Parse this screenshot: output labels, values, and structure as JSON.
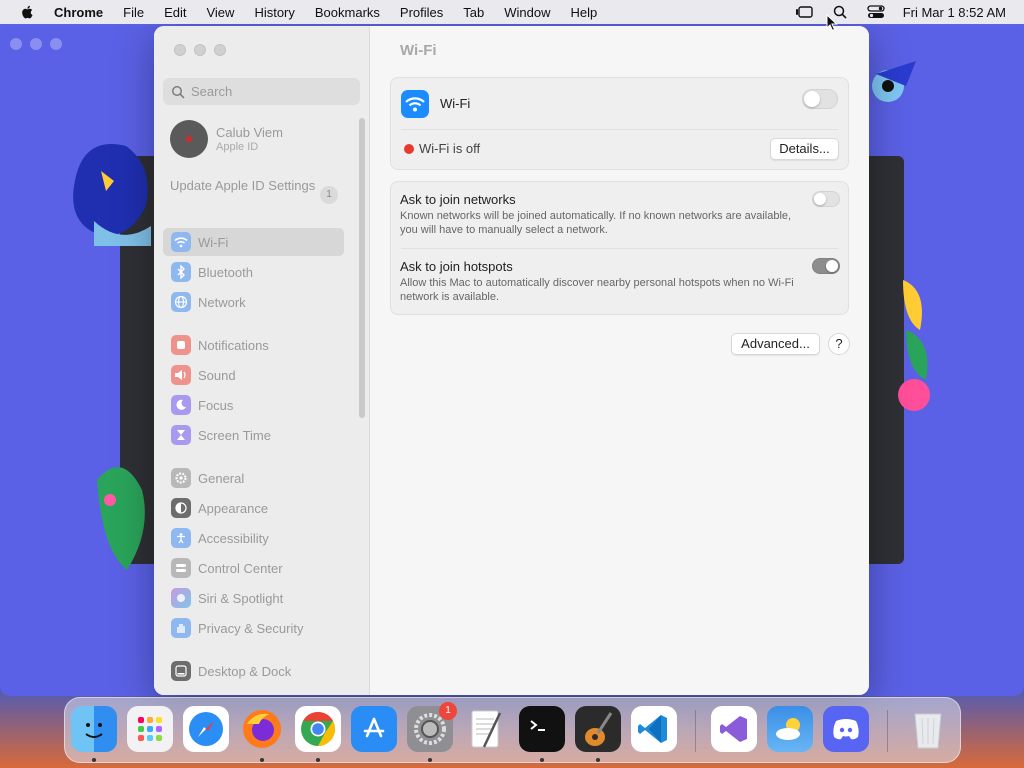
{
  "menubar": {
    "app_name": "Chrome",
    "items": [
      "File",
      "Edit",
      "View",
      "History",
      "Bookmarks",
      "Profiles",
      "Tab",
      "Window",
      "Help"
    ],
    "clock": "Fri Mar 1  8:52 AM"
  },
  "sidebar": {
    "search_placeholder": "Search",
    "profile": {
      "name": "Calub Viem",
      "subtitle": "Apple ID"
    },
    "update": {
      "label": "Update Apple ID Settings",
      "count": "1"
    },
    "items": [
      {
        "label": "Wi-Fi",
        "icon": "wifi-icon",
        "color": "#8fb8f0"
      },
      {
        "label": "Bluetooth",
        "icon": "bluetooth-icon",
        "color": "#8fb8f0"
      },
      {
        "label": "Network",
        "icon": "globe-icon",
        "color": "#8fb8f0"
      },
      {
        "label": "Notifications",
        "icon": "bell-icon",
        "color": "#f0928c"
      },
      {
        "label": "Sound",
        "icon": "speaker-icon",
        "color": "#f0928c"
      },
      {
        "label": "Focus",
        "icon": "moon-icon",
        "color": "#a99af0"
      },
      {
        "label": "Screen Time",
        "icon": "hourglass-icon",
        "color": "#a99af0"
      },
      {
        "label": "General",
        "icon": "gear-icon",
        "color": "#b8b8b8"
      },
      {
        "label": "Appearance",
        "icon": "appearance-icon",
        "color": "#6d6d6d"
      },
      {
        "label": "Accessibility",
        "icon": "accessibility-icon",
        "color": "#8fb8f0"
      },
      {
        "label": "Control Center",
        "icon": "control-center-icon",
        "color": "#b8b8b8"
      },
      {
        "label": "Siri & Spotlight",
        "icon": "siri-icon",
        "color": "#c79ae0"
      },
      {
        "label": "Privacy & Security",
        "icon": "hand-icon",
        "color": "#8fb8f0"
      },
      {
        "label": "Desktop & Dock",
        "icon": "dock-icon",
        "color": "#6d6d6d"
      }
    ]
  },
  "content": {
    "title": "Wi-Fi",
    "wifi_label": "Wi-Fi",
    "status": "Wi-Fi is off",
    "details_button": "Details...",
    "ask_networks": {
      "title": "Ask to join networks",
      "desc": "Known networks will be joined automatically. If no known networks are available, you will have to manually select a network."
    },
    "ask_hotspots": {
      "title": "Ask to join hotspots",
      "desc": "Allow this Mac to automatically discover nearby personal hotspots when no Wi-Fi network is available."
    },
    "advanced_button": "Advanced...",
    "help_button": "?"
  },
  "dock": {
    "apps": [
      "Finder",
      "Launchpad",
      "Safari",
      "Firefox",
      "Chrome",
      "App Store",
      "System Settings",
      "TextEdit",
      "Terminal",
      "GarageBand",
      "Visual Studio Code",
      "Visual Studio",
      "Weather",
      "Discord",
      "Trash"
    ],
    "settings_badge": "1"
  }
}
